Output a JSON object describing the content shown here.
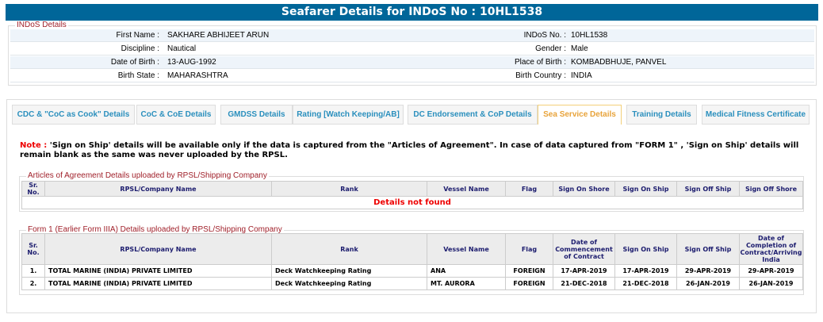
{
  "title": "Seafarer Details for INDoS No : 10HL1538",
  "indos": {
    "legend": "INDoS Details",
    "rows": [
      {
        "l1": "First Name :",
        "v1": "SAKHARE ABHIJEET ARUN",
        "l2": "INDoS No. :",
        "v2": "10HL1538"
      },
      {
        "l1": "Discipline :",
        "v1": "Nautical",
        "l2": "Gender :",
        "v2": "Male"
      },
      {
        "l1": "Date of Birth :",
        "v1": "13-AUG-1992",
        "l2": "Place of Birth :",
        "v2": "KOMBADBHUJE, PANVEL"
      },
      {
        "l1": "Birth State :",
        "v1": "MAHARASHTRA",
        "l2": "Birth Country :",
        "v2": "INDIA"
      }
    ]
  },
  "tabs": [
    {
      "label": "CDC & \"CoC as Cook\" Details"
    },
    {
      "label": "CoC & CoE Details"
    },
    {
      "label": "GMDSS Details"
    },
    {
      "label": "Rating [Watch Keeping/AB]"
    },
    {
      "label": "DC Endorsement & CoP Details"
    },
    {
      "label": "Sea Service Details",
      "active": true
    },
    {
      "label": "Training Details"
    },
    {
      "label": "Medical Fitness Certificate"
    }
  ],
  "note": {
    "prefix": "Note :",
    "text": " 'Sign on Ship' details will be available only if the data is captured from the \"Articles of Agreement\". In case of data captured from \"FORM 1\" , 'Sign on Ship' details will remain blank as the same was never uploaded by the RPSL."
  },
  "aoa": {
    "legend": "Articles of Agreement Details uploaded by RPSL/Shipping Company",
    "headers": [
      "Sr. No.",
      "RPSL/Company Name",
      "Rank",
      "Vessel Name",
      "Flag",
      "Sign On Shore",
      "Sign On Ship",
      "Sign Off Ship",
      "Sign Off Shore"
    ],
    "empty": "Details not found"
  },
  "form1": {
    "legend": "Form 1 (Earlier Form IIIA) Details uploaded by RPSL/Shipping Company",
    "headers": [
      "Sr. No.",
      "RPSL/Company Name",
      "Rank",
      "Vessel Name",
      "Flag",
      "Date of Commencement of Contract",
      "Sign On Ship",
      "Sign Off Ship",
      "Date of Completion of Contract/Arriving India"
    ],
    "rows": [
      [
        "1.",
        "TOTAL MARINE (INDIA) PRIVATE LIMITED",
        "Deck Watchkeeping Rating",
        "ANA",
        "FOREIGN",
        "17-APR-2019",
        "17-APR-2019",
        "29-APR-2019",
        "29-APR-2019"
      ],
      [
        "2.",
        "TOTAL MARINE (INDIA) PRIVATE LIMITED",
        "Deck Watchkeeping Rating",
        "MT. AURORA",
        "FOREIGN",
        "21-DEC-2018",
        "21-DEC-2018",
        "26-JAN-2019",
        "26-JAN-2019"
      ]
    ]
  }
}
